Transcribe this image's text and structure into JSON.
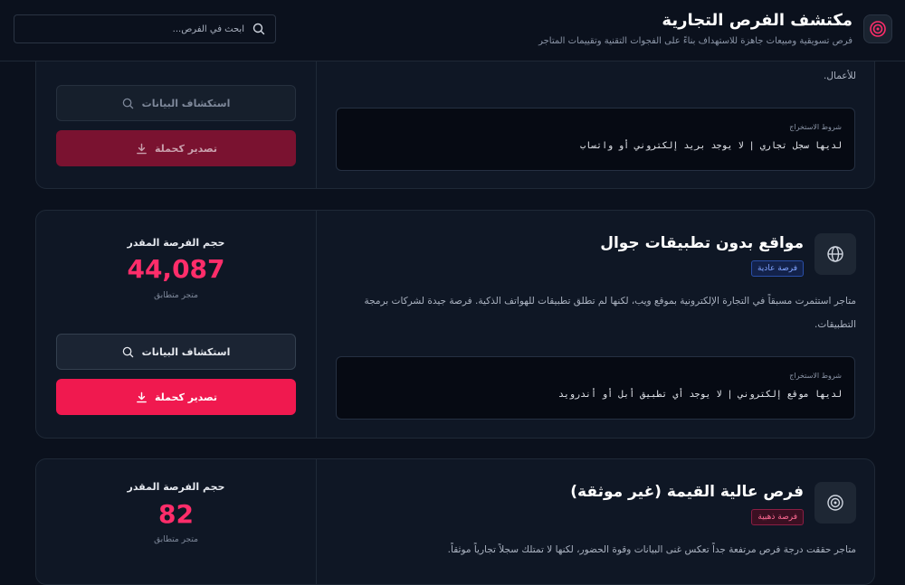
{
  "header": {
    "title": "مكتشف الفرص التجارية",
    "subtitle": "فرص تسويقية ومبيعات جاهزة للاستهداف بناءً على الفجوات التقنية وتقييمات المتاجر",
    "search_placeholder": "ابحث في الفرص...",
    "logo_icon": "target-icon",
    "search_icon": "search-icon"
  },
  "cards": [
    {
      "desc_tail": "للأعمال.",
      "conditions_label": "شروط الاستخراج",
      "conditions_value": "لديها سجل تجاري | لا يوجد بريد إلكتروني أو واتساب",
      "explore_label": "استكشاف البيانات",
      "export_label": "تصدير كحملة"
    },
    {
      "icon": "globe-icon",
      "title": "مواقع بدون تطبيقات جوال",
      "badge": "فرصة عادية",
      "description": "متاجر استثمرت مسبقاً في التجارة الإلكترونية بموقع ويب، لكنها لم تطلق تطبيقات للهواتف الذكية. فرصة جيدة لشركات برمجة التطبيقات.",
      "conditions_label": "شروط الاستخراج",
      "conditions_value": "لديها موقع إلكتروني | لا يوجد أي تطبيق أبل أو أندرويد",
      "stat_label": "حجم الفرصة المقدر",
      "stat_value": "44,087",
      "stat_sub": "متجر متطابق",
      "explore_label": "استكشاف البيانات",
      "export_label": "تصدير كحملة"
    },
    {
      "icon": "target-icon",
      "title": "فرص عالية القيمة (غير موثقة)",
      "badge": "فرصة ذهبية",
      "description": "متاجر حققت درجة فرص مرتفعة جداً تعكس غنى البيانات وقوة الحضور، لكنها لا تمتلك سجلاً تجارياً موثقاً.",
      "stat_label": "حجم الفرصة المقدر",
      "stat_value": "82",
      "stat_sub": "متجر متطابق"
    }
  ],
  "colors": {
    "accent": "#f0194f",
    "stat": "#ff2d6a",
    "background": "#0b111d"
  }
}
